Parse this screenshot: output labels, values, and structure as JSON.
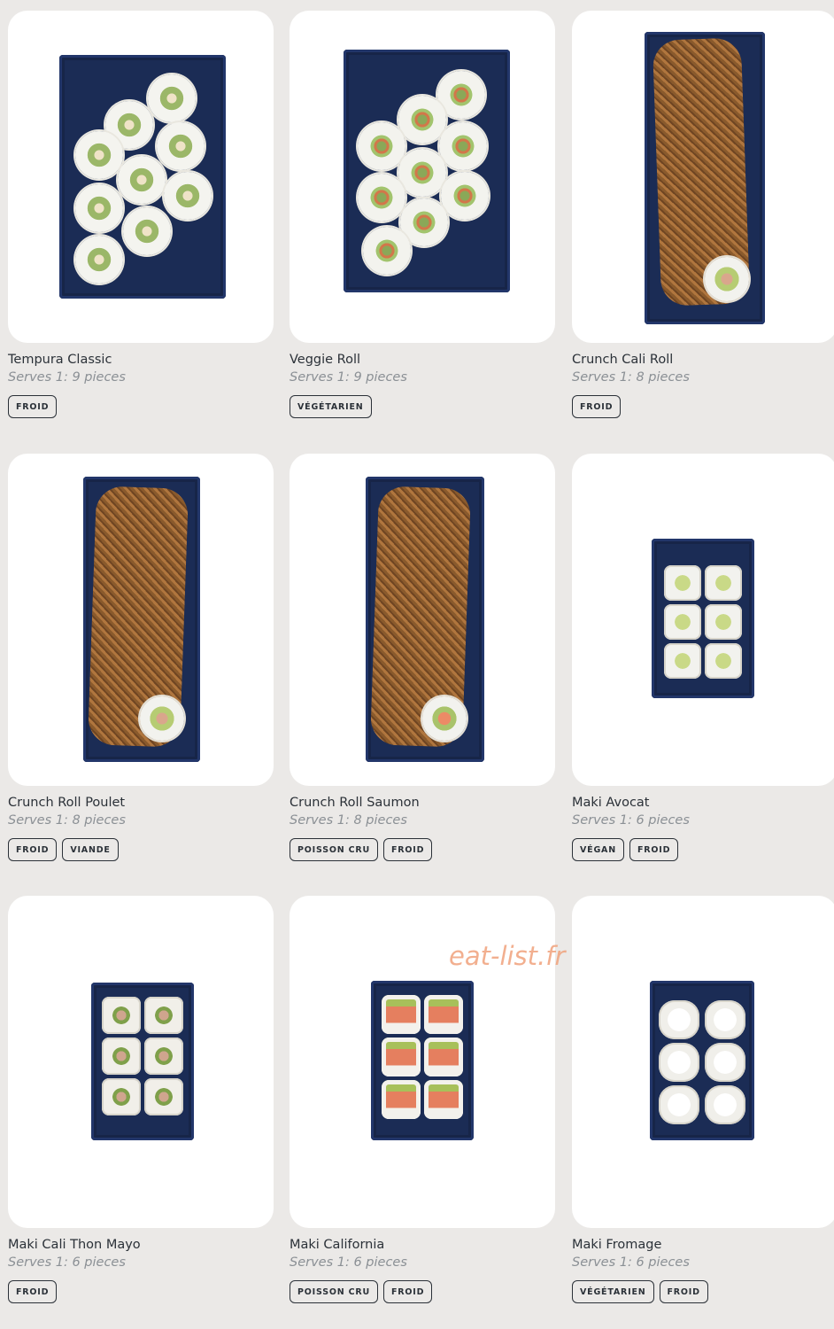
{
  "products": [
    {
      "name": "Tempura Classic",
      "serves": "Serves 1: 9 pieces",
      "tags": [
        "FROID"
      ]
    },
    {
      "name": "Veggie Roll",
      "serves": "Serves 1: 9 pieces",
      "tags": [
        "VÉGÉTARIEN"
      ]
    },
    {
      "name": "Crunch Cali Roll",
      "serves": "Serves 1: 8 pieces",
      "tags": [
        "FROID"
      ]
    },
    {
      "name": "Crunch Roll Poulet",
      "serves": "Serves 1: 8 pieces",
      "tags": [
        "FROID",
        "VIANDE"
      ]
    },
    {
      "name": "Crunch Roll Saumon",
      "serves": "Serves 1: 8 pieces",
      "tags": [
        "POISSON CRU",
        "FROID"
      ]
    },
    {
      "name": "Maki Avocat",
      "serves": "Serves 1: 6 pieces",
      "tags": [
        "VÉGAN",
        "FROID"
      ]
    },
    {
      "name": "Maki Cali Thon Mayo",
      "serves": "Serves 1: 6 pieces",
      "tags": [
        "FROID"
      ]
    },
    {
      "name": "Maki California",
      "serves": "Serves 1: 6 pieces",
      "tags": [
        "POISSON CRU",
        "FROID"
      ]
    },
    {
      "name": "Maki Fromage",
      "serves": "Serves 1: 6 pieces",
      "tags": [
        "VÉGÉTARIEN",
        "FROID"
      ]
    }
  ],
  "watermark": "eat-list.fr",
  "colors": {
    "background": "#ebe9e7",
    "card": "#ffffff",
    "tray": "#1b2c55",
    "text": "#2b3138",
    "muted": "#8b9095",
    "watermark": "#f0a27c"
  }
}
